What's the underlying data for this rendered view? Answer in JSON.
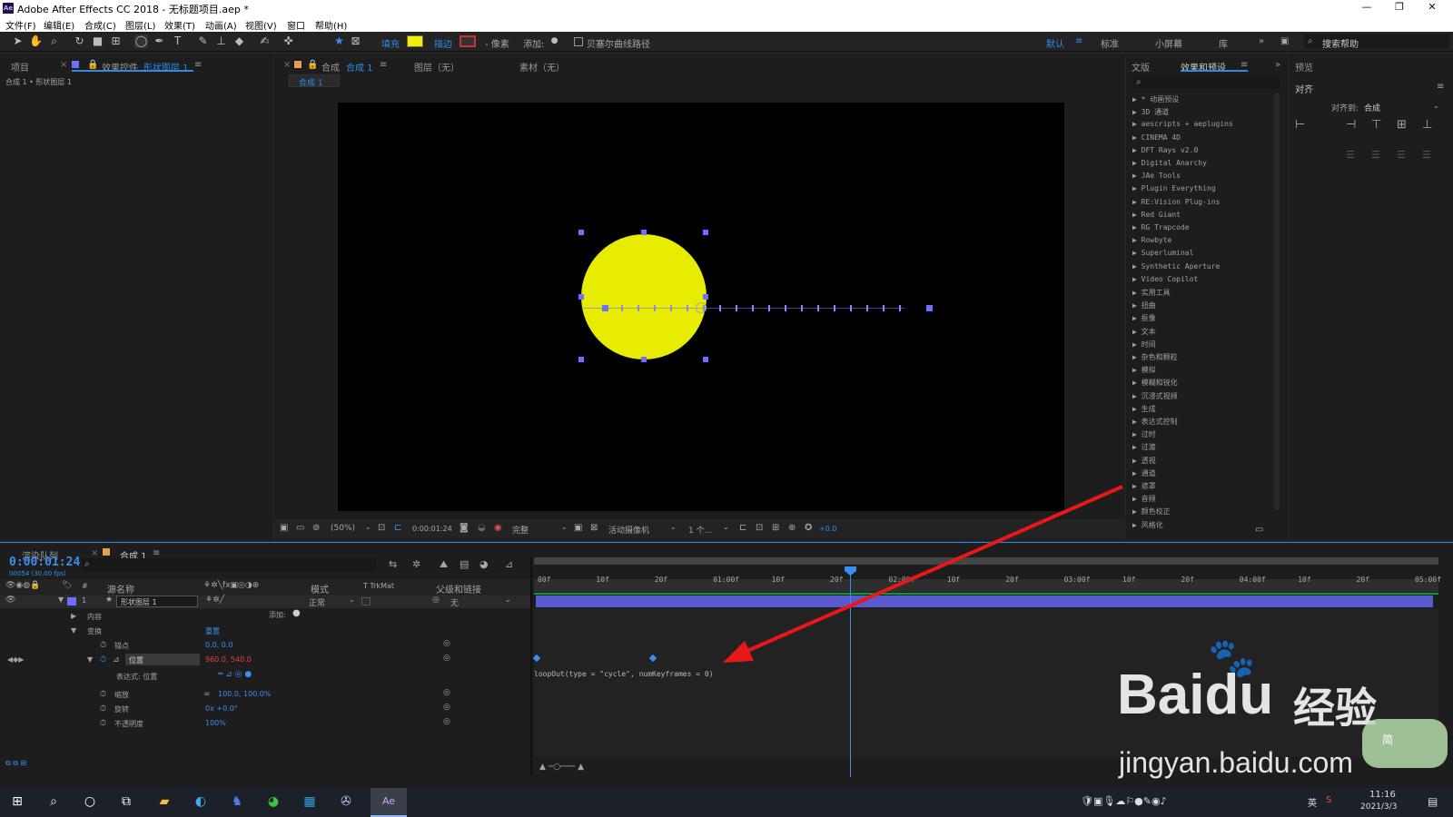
{
  "window": {
    "title": "Adobe After Effects CC 2018 - 无标题项目.aep *",
    "app_icon": "Ae",
    "controls": [
      "—",
      "❐",
      "✕"
    ]
  },
  "menu": [
    "文件(F)",
    "编辑(E)",
    "合成(C)",
    "图层(L)",
    "效果(T)",
    "动画(A)",
    "视图(V)",
    "窗口",
    "帮助(H)"
  ],
  "toolbar": {
    "fill_label": "填充",
    "stroke_label": "描边",
    "pixels": "- 像素",
    "add_label": "添加:",
    "bezier_label": "贝塞尔曲线路径",
    "workspaces": [
      "默认",
      "标准",
      "小屏幕",
      "库"
    ],
    "search_placeholder": "搜索帮助",
    "fill_color": "#f0f000",
    "stroke_color": "#c83232"
  },
  "project_panel": {
    "tab_project": "项目",
    "tab_effects": "效果控件",
    "effects_layer": "形状图层 1",
    "breadcrumb": "合成 1 • 形状图层 1"
  },
  "viewer": {
    "tab_comp": "合成",
    "comp_name": "合成 1",
    "tab_layer": "图层（无）",
    "tab_footage": "素材（无）",
    "comp_sub_tab": "合成 1",
    "zoom": "(50%)",
    "timecode": "0:00:01:24",
    "quality": "完整",
    "camera": "活动摄像机",
    "views": "1 个...",
    "exposure": "+0.0"
  },
  "right_panel": {
    "tab_text": "文版",
    "tab_effects": "效果和预设",
    "tab_preview": "预览",
    "tab_align": "对齐",
    "align_to_label": "对齐到:",
    "align_to": "合成",
    "effects": [
      "* 动画预设",
      "3D 通道",
      "aescripts + aeplugins",
      "CINEMA 4D",
      "DFT Rays v2.0",
      "Digital Anarchy",
      "JAe Tools",
      "Plugin Everything",
      "RE:Vision Plug-ins",
      "Red Giant",
      "RG Trapcode",
      "Rowbyte",
      "Superluminal",
      "Synthetic Aperture",
      "Video Copilot",
      "实用工具",
      "扭曲",
      "抠像",
      "文本",
      "时间",
      "杂色和颗粒",
      "模拟",
      "模糊和锐化",
      "沉浸式视频",
      "生成",
      "表达式控制",
      "过时",
      "过渡",
      "透视",
      "通道",
      "遮罩",
      "音频",
      "颜色校正",
      "风格化"
    ]
  },
  "timeline": {
    "tab_render": "渲染队列",
    "tab_comp": "合成 1",
    "timecode": "0:00:01:24",
    "frame_info": "00054 (30.00 fps)",
    "columns": {
      "source_name": "源名称",
      "mode": "模式",
      "trkmat": "T  TrkMat",
      "parent": "父级和链接"
    },
    "layer": {
      "index": "1",
      "name": "形状图层 1",
      "mode": "正常",
      "parent": "无"
    },
    "props": {
      "contents": "内容",
      "add": "添加:",
      "transform": "变换",
      "reset": "重置",
      "anchor": "锚点",
      "anchor_val": "0.0, 0.0",
      "position": "位置",
      "position_val": "960.0, 540.0",
      "expression_label": "表达式: 位置",
      "scale": "缩放",
      "scale_val": "100.0, 100.0%",
      "rotation": "旋转",
      "rotation_val": "0x +0.0°",
      "opacity": "不透明度",
      "opacity_val": "100%"
    },
    "expression": "loopOut(type = \"cycle\", numKeyframes = 0)",
    "ruler": [
      "00f",
      "10f",
      "20f",
      "01:00f",
      "10f",
      "20f",
      "02:00f",
      "10f",
      "20f",
      "03:00f",
      "10f",
      "20f",
      "04:00f",
      "10f",
      "20f",
      "05:00f"
    ]
  },
  "watermark": {
    "brand": "Baidu",
    "brand_cn": "经验",
    "url": "jingyan.baidu.com",
    "badge": "简"
  },
  "taskbar": {
    "time": "11:16",
    "date": "2021/3/3",
    "lang": "英"
  }
}
